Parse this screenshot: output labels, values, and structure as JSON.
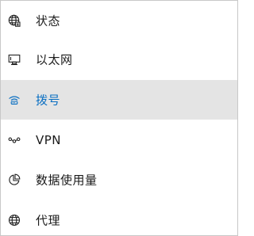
{
  "nav": {
    "items": [
      {
        "label": "状态",
        "icon": "globe-status-icon",
        "selected": false
      },
      {
        "label": "以太网",
        "icon": "ethernet-icon",
        "selected": false
      },
      {
        "label": "拨号",
        "icon": "dialup-icon",
        "selected": true
      },
      {
        "label": "VPN",
        "icon": "vpn-icon",
        "selected": false
      },
      {
        "label": "数据使用量",
        "icon": "data-usage-icon",
        "selected": false
      },
      {
        "label": "代理",
        "icon": "globe-proxy-icon",
        "selected": false
      }
    ]
  },
  "colors": {
    "selected_background": "#e4e4e4",
    "selected_text": "#0a6fc2",
    "text": "#1a1a1a",
    "border": "#c8c8c8"
  }
}
